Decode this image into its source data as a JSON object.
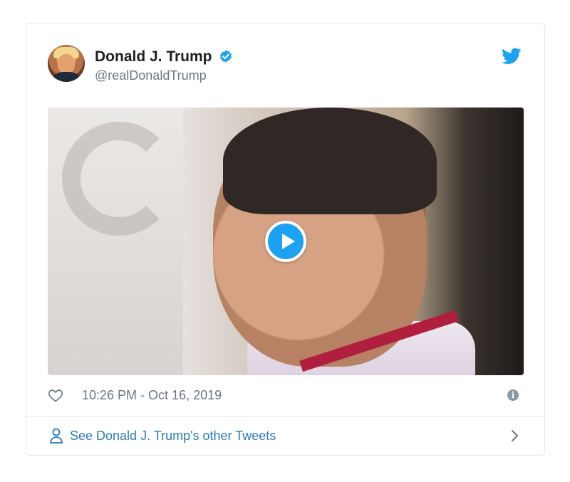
{
  "tweet": {
    "author": {
      "display_name": "Donald J. Trump",
      "handle": "@realDonaldTrump",
      "verified": true,
      "avatar_icon": "profile-photo"
    },
    "media": {
      "type": "video",
      "play_icon": "play-icon"
    },
    "like_icon": "heart-outline-icon",
    "timestamp": "10:26 PM - Oct 16, 2019",
    "info_icon": "info-icon",
    "footer": {
      "icon": "person-icon",
      "label": "See Donald J. Trump's other Tweets",
      "chevron": "chevron-right-icon"
    }
  },
  "colors": {
    "twitter_blue": "#1da1f2",
    "link_blue": "#2b7bb9",
    "secondary_text": "#697882",
    "border": "#e1e8ed"
  }
}
